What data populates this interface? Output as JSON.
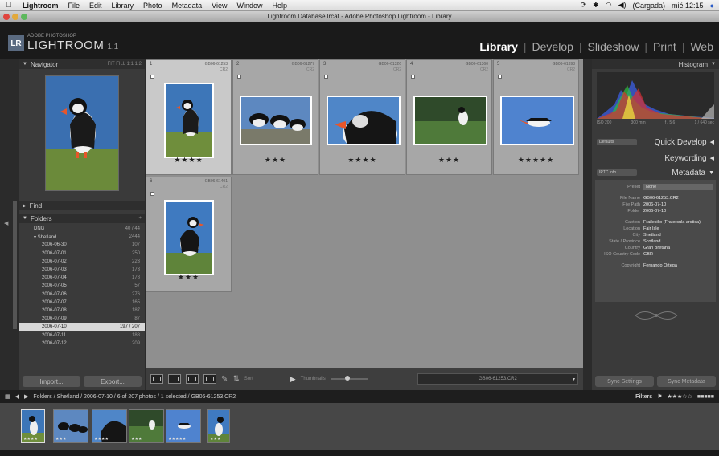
{
  "menubar": {
    "app": "Lightroom",
    "items": [
      "File",
      "Edit",
      "Library",
      "Photo",
      "Metadata",
      "View",
      "Window",
      "Help"
    ],
    "status": "(Cargada)",
    "clock": "mié 12:15"
  },
  "window": {
    "title": "Lightroom Database.lrcat - Adobe Photoshop Lightroom - Library"
  },
  "lr": {
    "small": "ADOBE PHOTOSHOP",
    "name": "LIGHTROOM",
    "version": "1.1",
    "modules": [
      "Library",
      "Develop",
      "Slideshow",
      "Print",
      "Web"
    ],
    "active_module": "Library"
  },
  "left": {
    "navigator": "Navigator",
    "nav_opts": "FIT  FILL  1:1  1:2",
    "find": "Find",
    "folders": "Folders",
    "folder_rows": [
      {
        "name": "DNG",
        "count": "40 / 44"
      },
      {
        "name": "▾ Shetland",
        "count": "2444"
      },
      {
        "name": "2006-06-30",
        "count": "107"
      },
      {
        "name": "2006-07-01",
        "count": "250"
      },
      {
        "name": "2006-07-02",
        "count": "223"
      },
      {
        "name": "2006-07-03",
        "count": "173"
      },
      {
        "name": "2006-07-04",
        "count": "178"
      },
      {
        "name": "2006-07-05",
        "count": "57"
      },
      {
        "name": "2006-07-06",
        "count": "276"
      },
      {
        "name": "2006-07-07",
        "count": "165"
      },
      {
        "name": "2006-07-08",
        "count": "187"
      },
      {
        "name": "2006-07-09",
        "count": "87"
      },
      {
        "name": "2006-07-10",
        "count": "197 / 207"
      },
      {
        "name": "2006-07-11",
        "count": "188"
      },
      {
        "name": "2006-07-12",
        "count": "209"
      }
    ],
    "selected_folder_index": 12,
    "import": "Import...",
    "export": "Export..."
  },
  "grid": {
    "cells": [
      {
        "idx": "1",
        "file": "GB06-61253",
        "stars": "★★★★"
      },
      {
        "idx": "2",
        "file": "GB06-61277",
        "stars": "★★★"
      },
      {
        "idx": "3",
        "file": "GB06-61326",
        "stars": "★★★★"
      },
      {
        "idx": "4",
        "file": "GB06-61360",
        "stars": "★★★"
      },
      {
        "idx": "5",
        "file": "GB06-61398",
        "stars": "★★★★★"
      },
      {
        "idx": "6",
        "file": "GB06-61401",
        "stars": "★★★"
      }
    ],
    "ext": "CR2"
  },
  "toolbar": {
    "sort": "Sort",
    "thumbnails": "Thumbnails",
    "filename": "GB06-61253.CR2"
  },
  "right": {
    "histogram": "Histogram",
    "hist_info": [
      "ISO 200",
      "300 mm",
      "f / 5.6",
      "1 / 640 sec"
    ],
    "defaults": "Defaults",
    "quick_develop": "Quick Develop",
    "keywording": "Keywording",
    "metadata_select": "IPTC Info",
    "metadata": "Metadata",
    "preset_label": "Preset",
    "preset_value": "None",
    "meta_rows": [
      {
        "label": "File Name",
        "value": "GB06-61253.CR2"
      },
      {
        "label": "File Path",
        "value": "2006-07-10"
      },
      {
        "label": "Folder",
        "value": "2006-07-10"
      },
      {
        "label": "",
        "value": ""
      },
      {
        "label": "Caption",
        "value": "Frailecillo (Fratercula arctica)"
      },
      {
        "label": "Location",
        "value": "Fair Isle"
      },
      {
        "label": "City",
        "value": "Shetland"
      },
      {
        "label": "State / Province",
        "value": "Scotland"
      },
      {
        "label": "Country",
        "value": "Gran Bretaña"
      },
      {
        "label": "ISO Country Code",
        "value": "GBR"
      },
      {
        "label": "",
        "value": ""
      },
      {
        "label": "Copyright",
        "value": "Fernando Ortega"
      }
    ],
    "sync_settings": "Sync Settings",
    "sync_metadata": "Sync Metadata"
  },
  "status": {
    "breadcrumb": "Folders / Shetland / 2006-07-10 / 6 of 207 photos / 1 selected / GB06-61253.CR2",
    "filters": "Filters",
    "stars": "★★★☆☆"
  },
  "filmstrip": {
    "stars": [
      "★★★★",
      "★★★",
      "★★★★",
      "★★★",
      "★★★★★",
      "★★★"
    ]
  },
  "colors": {
    "accent": "#ffffff",
    "grid_bg": "#8f8f8f",
    "panel_bg": "#3a3a3a"
  }
}
